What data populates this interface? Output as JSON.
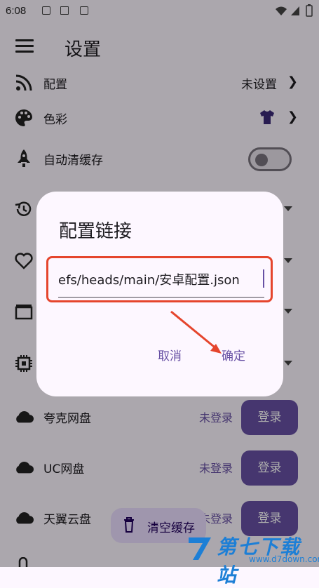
{
  "status_bar": {
    "time": "6:08"
  },
  "appbar": {
    "title": "设置"
  },
  "settings": {
    "config": {
      "label": "配置",
      "value": "未设置"
    },
    "color": {
      "label": "色彩"
    },
    "auto_clean": {
      "label": "自动清缓存"
    }
  },
  "cloud": {
    "quark": {
      "label": "夸克网盘",
      "status": "未登录",
      "button": "登录"
    },
    "uc": {
      "label": "UC网盘",
      "status": "未登录",
      "button": "登录"
    },
    "tianyi": {
      "label": "天翼云盘",
      "status": "未登录",
      "button": "登录"
    }
  },
  "fab": {
    "label": "清空缓存"
  },
  "dialog": {
    "title": "配置链接",
    "input_value": "efs/heads/main/安卓配置.json",
    "cancel": "取消",
    "confirm": "确定"
  },
  "watermark": {
    "text": "第七下载站",
    "url": "www.d7down.com"
  },
  "colors": {
    "primary": "#6750a4",
    "highlight": "#e5452d",
    "shirt": "#3b2a78"
  }
}
